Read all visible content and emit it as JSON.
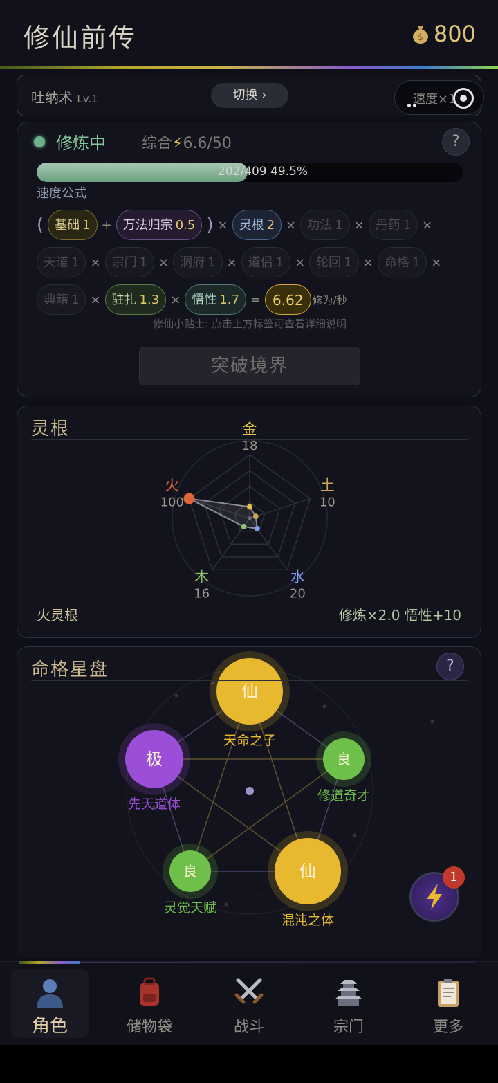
{
  "header": {
    "title": "修仙前传",
    "coins": "800",
    "coin_icon": "money-bag-icon"
  },
  "art": {
    "name": "吐纳术",
    "level": "Lv.1",
    "switch_label": "切换 ›",
    "speed_label": "速度×1"
  },
  "cultivate": {
    "status": "修炼中",
    "overall_label": "综合",
    "overall_value": "6.6/50",
    "help": "?",
    "progress_text": "202/409  49.5%",
    "progress_fraction": 0.495,
    "formula_label": "速度公式",
    "tag_base": {
      "name": "基础",
      "n": "1"
    },
    "tag_wanfa": {
      "name": "万法归宗",
      "n": "0.5"
    },
    "tag_lingen": {
      "name": "灵根",
      "n": "2"
    },
    "tag_gongfa": {
      "name": "功法",
      "n": "1"
    },
    "tag_danyao": {
      "name": "丹药",
      "n": "1"
    },
    "tag_tiandao": {
      "name": "天道",
      "n": "1"
    },
    "tag_zongmen": {
      "name": "宗门",
      "n": "1"
    },
    "tag_dongfu": {
      "name": "洞府",
      "n": "1"
    },
    "tag_daolv": {
      "name": "道侣",
      "n": "1"
    },
    "tag_lunhui": {
      "name": "轮回",
      "n": "1"
    },
    "tag_mingge": {
      "name": "命格",
      "n": "1"
    },
    "tag_dianji": {
      "name": "典籍",
      "n": "1"
    },
    "tag_zhuzha": {
      "name": "驻扎",
      "n": "1.3"
    },
    "tag_wuxing": {
      "name": "悟性",
      "n": "1.7"
    },
    "result": "6.62",
    "unit": "修为/秒",
    "op_plus": "+",
    "op_times": "×",
    "op_eq": "=",
    "paren_open": "(",
    "paren_close": ")",
    "tip": "修仙小贴士: 点击上方标签可查看详细说明",
    "breakthrough_label": "突破境界"
  },
  "lingen": {
    "title": "灵根",
    "elements": [
      {
        "name": "金",
        "value": "18",
        "color": "#e3c24a"
      },
      {
        "name": "土",
        "value": "10",
        "color": "#c9a45a"
      },
      {
        "name": "水",
        "value": "20",
        "color": "#7a9cf0"
      },
      {
        "name": "木",
        "value": "16",
        "color": "#8fc56a"
      },
      {
        "name": "火",
        "value": "100",
        "color": "#e0643a"
      }
    ],
    "root_name": "火灵根",
    "bonus": "修炼×2.0  悟性+10"
  },
  "mingge": {
    "title": "命格星盘",
    "help": "?",
    "stars": [
      {
        "glyph": "仙",
        "label": "天命之子",
        "color": "#e8b92e"
      },
      {
        "glyph": "良",
        "label": "修道奇才",
        "color": "#6ec04a"
      },
      {
        "glyph": "仙",
        "label": "混沌之体",
        "color": "#e8b92e"
      },
      {
        "glyph": "良",
        "label": "灵觉天赋",
        "color": "#6ec04a"
      },
      {
        "glyph": "极",
        "label": "先天道体",
        "color": "#9b4fd8"
      }
    ]
  },
  "fab": {
    "badge": "1",
    "icon": "lightning-icon"
  },
  "tabs": [
    {
      "label": "角色",
      "icon": "person-icon"
    },
    {
      "label": "储物袋",
      "icon": "backpack-icon"
    },
    {
      "label": "战斗",
      "icon": "crossed-swords-icon"
    },
    {
      "label": "宗门",
      "icon": "pagoda-icon"
    },
    {
      "label": "更多",
      "icon": "clipboard-icon"
    }
  ]
}
